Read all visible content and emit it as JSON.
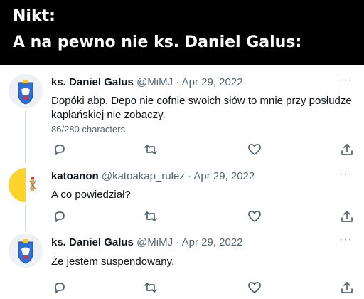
{
  "banner": {
    "line1": "Nikt:",
    "line2": "A na pewno nie ks. Daniel Galus:"
  },
  "tweets": [
    {
      "name": "ks. Daniel Galus",
      "handle": "@MiMJ",
      "separator": "·",
      "date": "Apr 29, 2022",
      "more": "···",
      "text": "Dopóki abp. Depo nie cofnie swoich słów to mnie przy posłudze kapłańskiej nie zobaczy.",
      "char_count": "86/280 characters",
      "avatar_icon": "coat-of-arms-blue-icon"
    },
    {
      "name": "katoanon",
      "handle": "@katoakap_rulez",
      "separator": "·",
      "date": "Apr 29, 2022",
      "more": "···",
      "text": "A co powiedział?",
      "avatar_icon": "vatican-flag-icon"
    },
    {
      "name": "ks. Daniel Galus",
      "handle": "@MiMJ",
      "separator": "·",
      "date": "Apr 29, 2022",
      "more": "···",
      "text": "Że jestem suspendowany.",
      "avatar_icon": "coat-of-arms-blue-icon"
    }
  ],
  "action_icons": [
    "reply-icon",
    "retweet-icon",
    "like-icon",
    "share-icon"
  ],
  "colors": {
    "banner_bg": "#000000",
    "text": "#0f1419",
    "secondary": "#536471",
    "thread_line": "#cfd9de"
  }
}
